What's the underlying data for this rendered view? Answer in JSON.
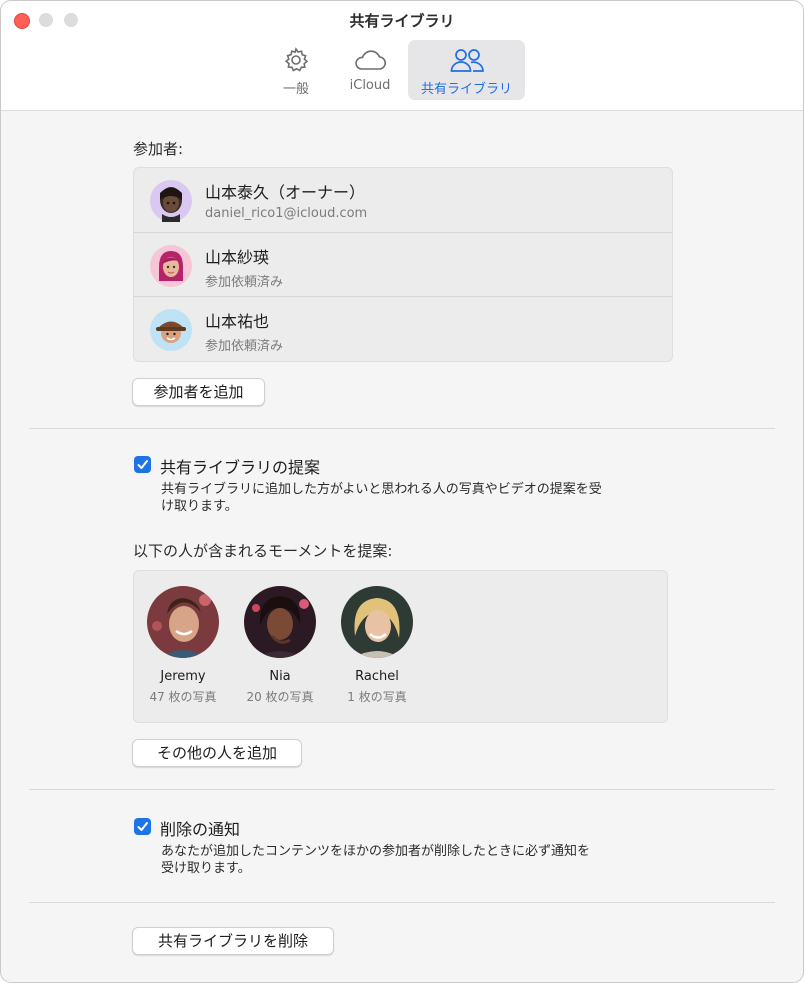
{
  "window": {
    "title": "共有ライブラリ"
  },
  "tabs": [
    {
      "label": "一般",
      "icon": "gear-icon"
    },
    {
      "label": "iCloud",
      "icon": "cloud-icon"
    },
    {
      "label": "共有ライブラリ",
      "icon": "people-icon",
      "selected": true
    }
  ],
  "participants": {
    "heading": "参加者:",
    "items": [
      {
        "name": "山本泰久（オーナー）",
        "detail": "daniel_rico1@icloud.com",
        "avatar": "memoji-avatar"
      },
      {
        "name": "山本紗瑛",
        "detail": "参加依頼済み",
        "avatar": "memoji-avatar"
      },
      {
        "name": "山本祐也",
        "detail": "参加依頼済み",
        "avatar": "memoji-avatar"
      }
    ],
    "add_button": "参加者を追加"
  },
  "suggestions": {
    "checked": true,
    "label": "共有ライブラリの提案",
    "description_line1": "共有ライブラリに追加した方がよいと思われる人の写真やビデオの提案を受",
    "description_line2": "け取ります。",
    "moments_heading": "以下の人が含まれるモーメントを提案:",
    "people": [
      {
        "name": "Jeremy",
        "count": "47 枚の写真"
      },
      {
        "name": "Nia",
        "count": "20 枚の写真"
      },
      {
        "name": "Rachel",
        "count": "1 枚の写真"
      }
    ],
    "add_button": "その他の人を追加"
  },
  "deletion": {
    "checked": true,
    "label": "削除の通知",
    "description_line1": "あなたが追加したコンテンツをほかの参加者が削除したときに必ず通知を",
    "description_line2": "受け取ります。"
  },
  "delete_library_button": "共有ライブラリを削除",
  "colors": {
    "accent": "#1f73e8",
    "selected_tab_text": "#1f6fe5",
    "close": "#ff5f57"
  }
}
